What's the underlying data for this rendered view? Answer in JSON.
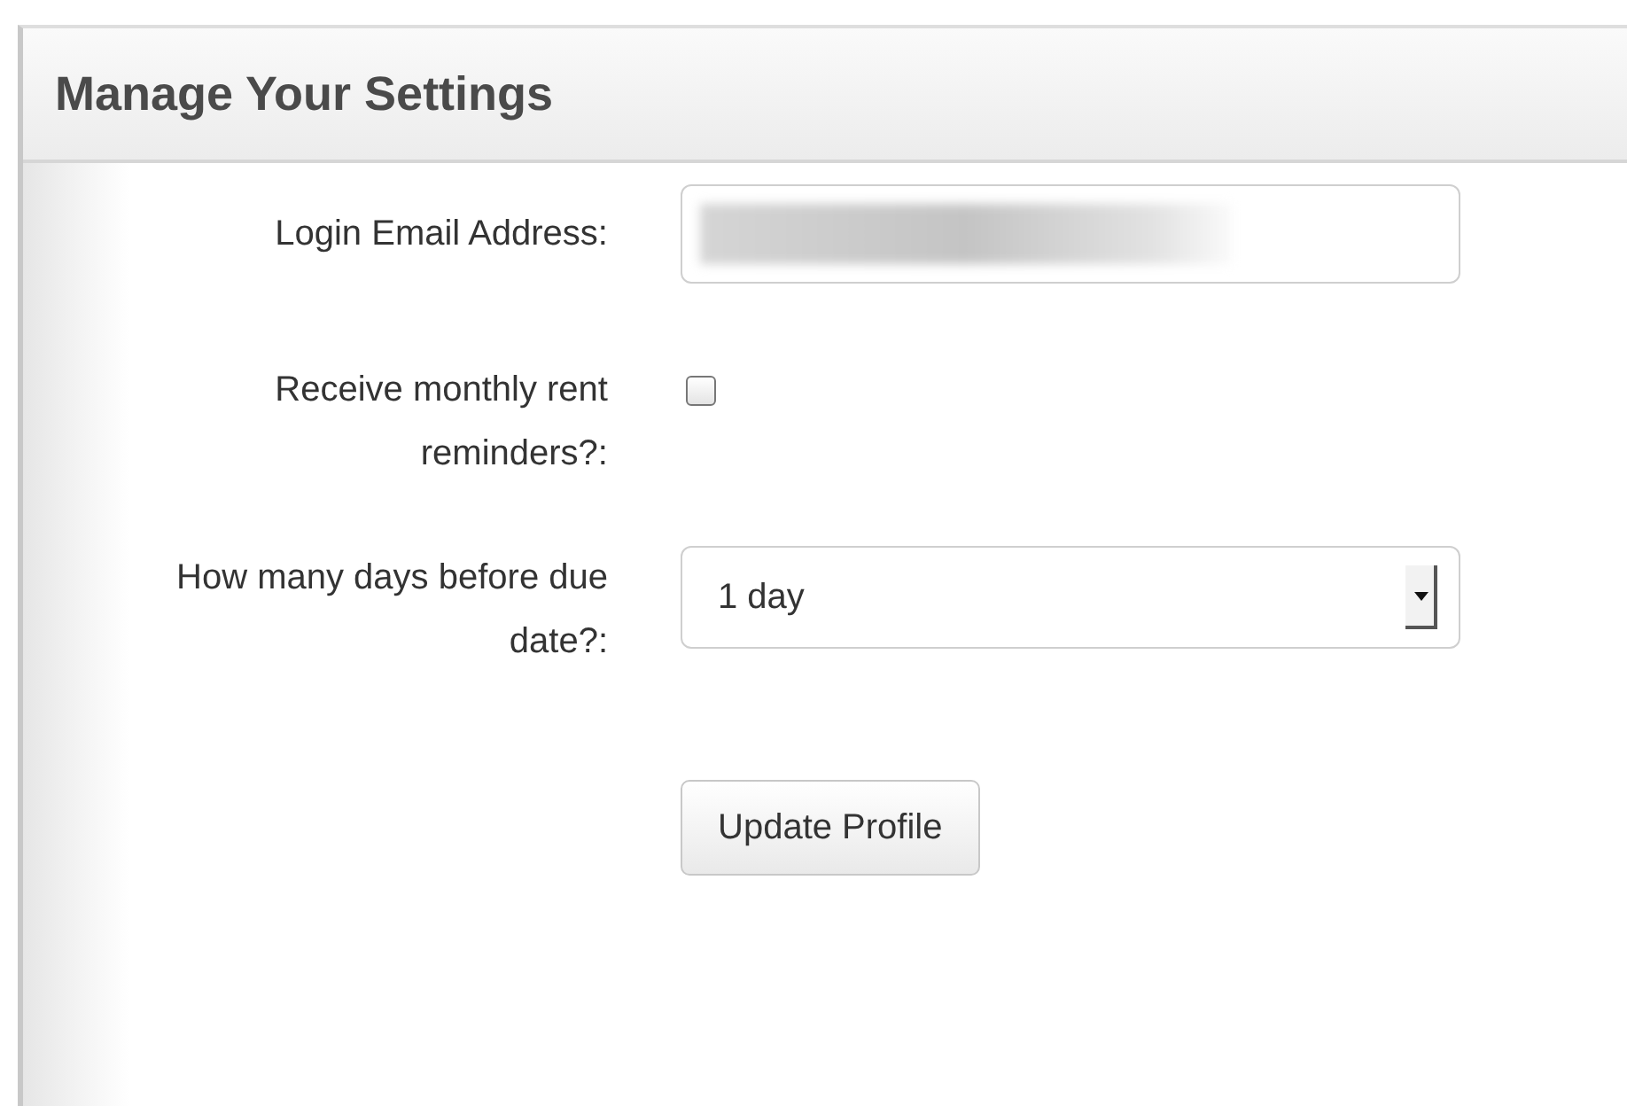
{
  "panel": {
    "title": "Manage Your Settings"
  },
  "fields": [
    {
      "kind": "text",
      "label": "Login Email Address:",
      "redacted": true
    },
    {
      "kind": "checkbox",
      "label": "Receive monthly rent reminders?:",
      "checked": false
    },
    {
      "kind": "select",
      "label": "How many days before due date?:",
      "value": "1 day"
    }
  ],
  "submit": {
    "label": "Update Profile"
  }
}
